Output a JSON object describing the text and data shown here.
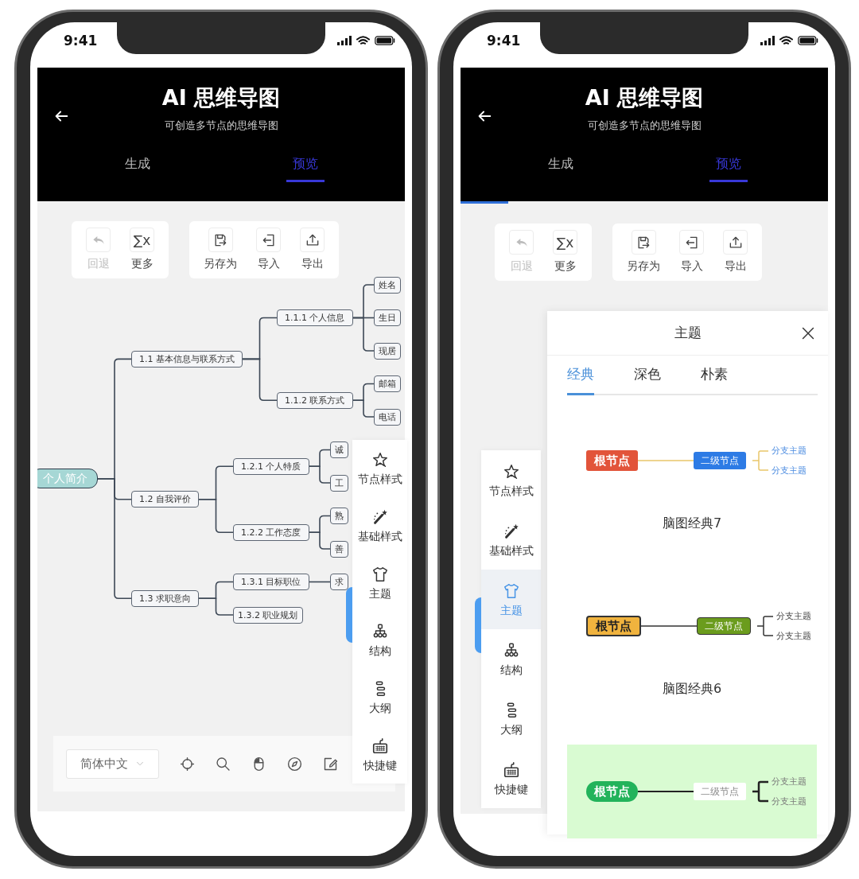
{
  "phones": [
    {
      "status_bar": {
        "time": "9:41"
      },
      "header": {
        "title": "AI 思维导图",
        "subtitle": "可创造多节点的思维导图"
      },
      "tabs": [
        {
          "label": "生成",
          "selected": false
        },
        {
          "label": "预览",
          "selected": true
        }
      ],
      "toolbar_groups": [
        {
          "items": [
            {
              "label": "回退",
              "disabled": true
            },
            {
              "label": "更多",
              "symbol": "∑x",
              "disabled": false
            }
          ]
        },
        {
          "items": [
            {
              "label": "另存为",
              "disabled": false
            },
            {
              "label": "导入",
              "disabled": false
            },
            {
              "label": "导出",
              "disabled": false
            }
          ]
        }
      ],
      "mind_map": {
        "root": {
          "label": "个人简介",
          "children": [
            {
              "label": "1.1 基本信息与联系方式",
              "children": [
                {
                  "label": "1.1.1 个人信息",
                  "children": [
                    {
                      "label": "姓名"
                    },
                    {
                      "label": "生日"
                    },
                    {
                      "label": "现居"
                    }
                  ]
                },
                {
                  "label": "1.1.2 联系方式",
                  "children": [
                    {
                      "label": "邮箱"
                    },
                    {
                      "label": "电话"
                    }
                  ]
                }
              ]
            },
            {
              "label": "1.2 自我评价",
              "children": [
                {
                  "label": "1.2.1 个人特质",
                  "children": [
                    {
                      "label": "诚"
                    },
                    {
                      "label": "工"
                    }
                  ]
                },
                {
                  "label": "1.2.2 工作态度",
                  "children": [
                    {
                      "label": "熟"
                    },
                    {
                      "label": "善"
                    }
                  ]
                }
              ]
            },
            {
              "label": "1.3 求职意向",
              "children": [
                {
                  "label": "1.3.1 目标职位",
                  "children": [
                    {
                      "label": "求"
                    }
                  ]
                },
                {
                  "label": "1.3.2 职业规划"
                }
              ]
            }
          ]
        }
      },
      "side_menu": [
        {
          "label": "节点样式",
          "selected": false
        },
        {
          "label": "基础样式",
          "selected": false
        },
        {
          "label": "主题",
          "selected": false
        },
        {
          "label": "结构",
          "selected": false
        },
        {
          "label": "大纲",
          "selected": false
        },
        {
          "label": "快捷键",
          "selected": false
        }
      ],
      "bottom_bar": {
        "language": "简体中文"
      }
    },
    {
      "status_bar": {
        "time": "9:41"
      },
      "header": {
        "title": "AI 思维导图",
        "subtitle": "可创造多节点的思维导图"
      },
      "tabs": [
        {
          "label": "生成",
          "selected": false
        },
        {
          "label": "预览",
          "selected": true
        }
      ],
      "progress": {
        "level": 0.13
      },
      "toolbar_groups": [
        {
          "items": [
            {
              "label": "回退",
              "disabled": true
            },
            {
              "label": "更多",
              "symbol": "∑x",
              "disabled": false
            }
          ]
        },
        {
          "items": [
            {
              "label": "另存为",
              "disabled": false
            },
            {
              "label": "导入",
              "disabled": false
            },
            {
              "label": "导出",
              "disabled": false
            }
          ]
        }
      ],
      "side_menu": [
        {
          "label": "节点样式",
          "selected": false
        },
        {
          "label": "基础样式",
          "selected": false
        },
        {
          "label": "主题",
          "selected": true
        },
        {
          "label": "结构",
          "selected": false
        },
        {
          "label": "大纲",
          "selected": false
        },
        {
          "label": "快捷键",
          "selected": false
        }
      ],
      "theme_panel": {
        "title": "主题",
        "tabs": [
          {
            "label": "经典",
            "selected": true
          },
          {
            "label": "深色",
            "selected": false
          },
          {
            "label": "朴素",
            "selected": false
          }
        ],
        "themes": [
          {
            "name": "脑图经典7",
            "root": "根节点",
            "secondary": "二级节点",
            "branches": [
              "分支主题",
              "分支主题"
            ]
          },
          {
            "name": "脑图经典6",
            "root": "根节点",
            "secondary": "二级节点",
            "branches": [
              "分支主题",
              "分支主题"
            ]
          },
          {
            "root": "根节点",
            "secondary": "二级节点",
            "branches": [
              "分支主题",
              "分支主题"
            ]
          }
        ]
      }
    }
  ]
}
